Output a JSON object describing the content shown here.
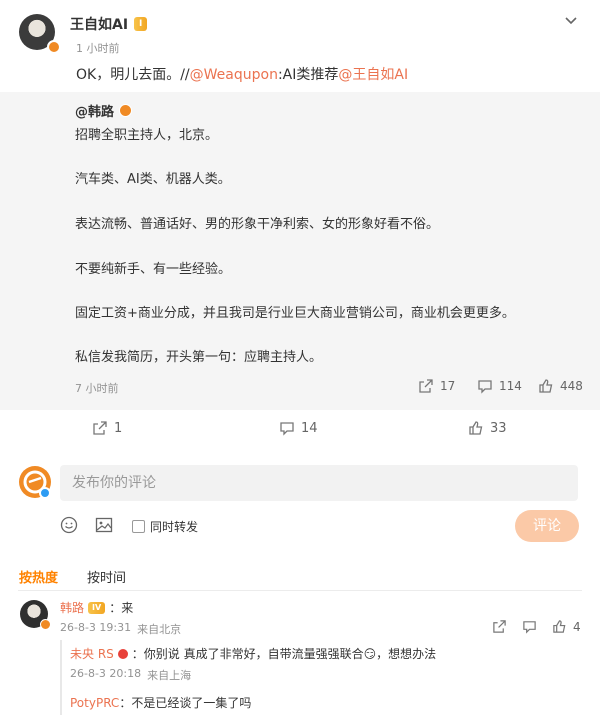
{
  "post": {
    "author_name": "王自如AI",
    "author_badge": "I",
    "time": "1 小时前",
    "text_prefix": "OK，明儿去面。//",
    "mention1": "@Weaqupon",
    "text_middle": ":AI类推荐",
    "mention2": "@王自如AI"
  },
  "repost": {
    "author": "@韩路",
    "lines": [
      "招聘全职主持人，北京。",
      "汽车类、AI类、机器人类。",
      "表达流畅、普通话好、男的形象干净利索、女的形象好看不俗。",
      "不要纯新手、有一些经验。",
      "固定工资+商业分成，并且我司是行业巨大商业营销公司，商业机会更更多。",
      "私信发我简历，开头第一句：应聘主持人。"
    ],
    "time": "7 小时前",
    "repost_count": "17",
    "comment_count": "114",
    "like_count": "448"
  },
  "actions": {
    "repost_count": "1",
    "comment_count": "14",
    "like_count": "33"
  },
  "comment_box": {
    "placeholder": "发布你的评论",
    "also_repost_label": "同时转发",
    "submit_label": "评论"
  },
  "tabs": {
    "hot": "按热度",
    "time": "按时间"
  },
  "comment": {
    "name": "韩路",
    "badge": "IV",
    "text": "：来",
    "time": "26-8-3 19:31",
    "location": "来自北京",
    "like_count": "4",
    "replies": [
      {
        "name": "未央 RS",
        "text": "：你别说 真成了非常好，自带流量强强联合😏，想想办法",
        "time": "26-8-3 20:18",
        "location": "来自上海"
      },
      {
        "name": "PotyPRC",
        "text": "：不是已经谈了一集了吗"
      }
    ]
  },
  "colors": {
    "accent": "#ff8200",
    "link": "#eb7350",
    "repost_bg": "#f5f5f5"
  }
}
